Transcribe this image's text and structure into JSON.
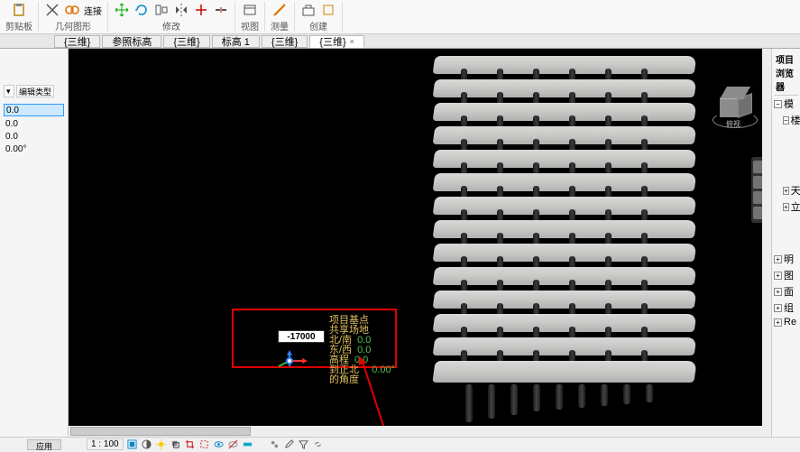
{
  "ribbon": {
    "groups": [
      {
        "label": "剪贴板"
      },
      {
        "label": "几何图形",
        "connect": "连接"
      },
      {
        "label": "修改"
      },
      {
        "label": "视图"
      },
      {
        "label": "测量"
      },
      {
        "label": "创建"
      }
    ]
  },
  "tabs": [
    {
      "label": "{三维}",
      "active": false
    },
    {
      "label": "参照标高",
      "active": false
    },
    {
      "label": "{三维}",
      "active": false
    },
    {
      "label": "标高 1",
      "active": false
    },
    {
      "label": "{三维}",
      "active": false
    },
    {
      "label": "{三维}",
      "active": true
    }
  ],
  "properties": {
    "toolbar_item": "编辑类型",
    "values": [
      "0.0",
      "0.0",
      "0.0",
      "0.00°"
    ]
  },
  "callout": {
    "input_value": "-17000",
    "info": {
      "title": "项目基点",
      "shared": "共享场地",
      "rows": [
        {
          "label": "北/南",
          "value": "0.0"
        },
        {
          "label": "东/西",
          "value": "0.0"
        },
        {
          "label": "高程",
          "value": "0.0"
        },
        {
          "label": "到正北的角度",
          "value": "0.00°"
        }
      ]
    }
  },
  "viewcube": {
    "label": "俯视"
  },
  "browser": {
    "title": "项目浏览器",
    "items": [
      "模",
      "楼",
      "天",
      "立",
      "明",
      "图",
      "面",
      "组",
      "Re"
    ]
  },
  "status": {
    "apply": "应用",
    "scale": "1 : 100"
  }
}
